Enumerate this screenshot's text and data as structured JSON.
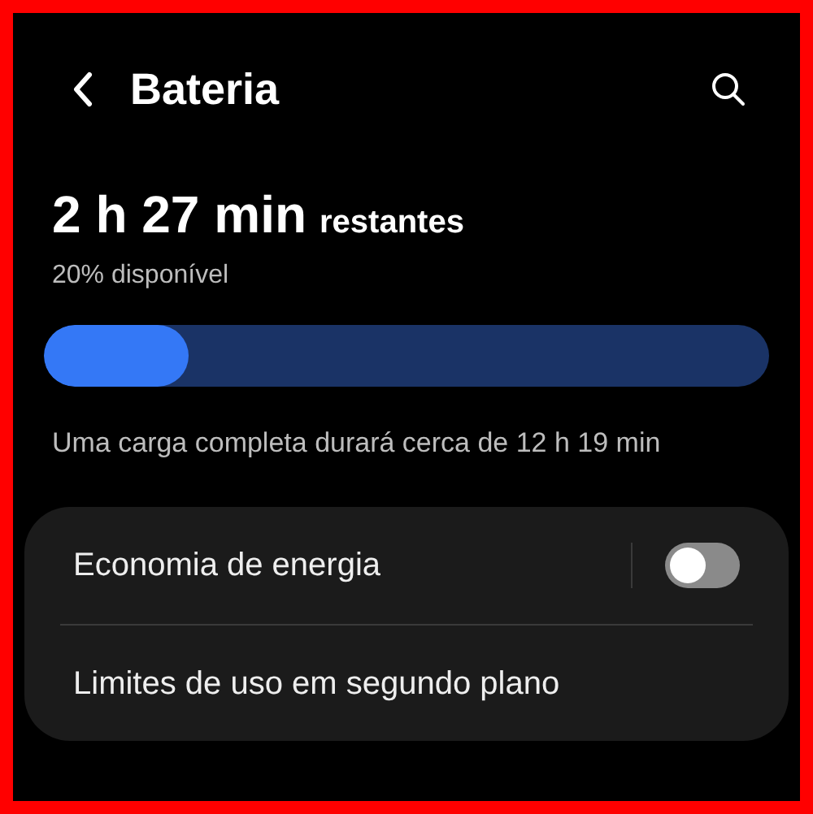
{
  "header": {
    "title": "Bateria"
  },
  "battery": {
    "time": "2 h 27 min",
    "suffix": "restantes",
    "available": "20% disponível",
    "level": 0.2,
    "note": "Uma carga completa durará cerca de 12 h 19 min"
  },
  "settings": [
    {
      "kind": "switch",
      "label": "Economia de energia",
      "on": false
    },
    {
      "kind": "link",
      "label": "Limites de uso em segundo plano"
    }
  ]
}
